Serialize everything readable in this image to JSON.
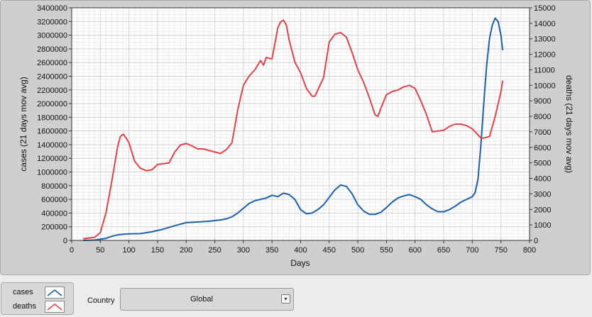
{
  "chart_data": {
    "type": "line",
    "xlabel": "Days",
    "ylabel_left": "cases  (21 days mov avg)",
    "ylabel_right": "deaths  (21 days mov avg)",
    "xlim": [
      0,
      800
    ],
    "ylim_left": [
      0,
      3400000
    ],
    "ylim_right": [
      0,
      15000
    ],
    "x_ticks": [
      "0",
      "50",
      "100",
      "150",
      "200",
      "250",
      "300",
      "350",
      "400",
      "450",
      "500",
      "550",
      "600",
      "650",
      "700",
      "750",
      "800"
    ],
    "y_ticks_left": [
      "0",
      "200000",
      "400000",
      "600000",
      "800000",
      "1000000",
      "1200000",
      "1400000",
      "1600000",
      "1800000",
      "2000000",
      "2200000",
      "2400000",
      "2600000",
      "2800000",
      "3000000",
      "3200000",
      "3400000"
    ],
    "y_ticks_right": [
      "0",
      "1000",
      "2000",
      "3000",
      "4000",
      "5000",
      "6000",
      "7000",
      "8000",
      "9000",
      "10000",
      "11000",
      "12000",
      "13000",
      "14000",
      "15000"
    ],
    "grid": true,
    "series": [
      {
        "name": "cases",
        "axis": "left",
        "color": "#1f5fa6",
        "x": [
          20,
          40,
          60,
          70,
          80,
          90,
          100,
          120,
          140,
          160,
          180,
          200,
          220,
          240,
          260,
          270,
          280,
          290,
          300,
          310,
          320,
          330,
          340,
          350,
          360,
          370,
          380,
          390,
          400,
          410,
          420,
          430,
          440,
          450,
          460,
          470,
          480,
          490,
          500,
          510,
          520,
          530,
          540,
          550,
          560,
          570,
          580,
          590,
          600,
          610,
          620,
          630,
          640,
          650,
          660,
          670,
          680,
          690,
          700,
          705,
          710,
          715,
          720,
          725,
          730,
          735,
          740,
          745,
          750,
          753
        ],
        "y": [
          0,
          5000,
          30000,
          60000,
          80000,
          90000,
          95000,
          100000,
          125000,
          165000,
          215000,
          260000,
          270000,
          280000,
          300000,
          315000,
          345000,
          400000,
          470000,
          540000,
          580000,
          600000,
          620000,
          660000,
          640000,
          690000,
          670000,
          600000,
          450000,
          390000,
          400000,
          450000,
          520000,
          630000,
          740000,
          810000,
          790000,
          680000,
          520000,
          430000,
          380000,
          380000,
          410000,
          480000,
          560000,
          620000,
          650000,
          670000,
          640000,
          600000,
          520000,
          460000,
          420000,
          420000,
          450000,
          500000,
          560000,
          600000,
          640000,
          700000,
          900000,
          1400000,
          2000000,
          2550000,
          2950000,
          3150000,
          3250000,
          3200000,
          3000000,
          2780000
        ]
      },
      {
        "name": "deaths",
        "axis": "right",
        "color": "#e0434a",
        "x": [
          20,
          40,
          50,
          60,
          70,
          80,
          85,
          90,
          95,
          100,
          110,
          120,
          130,
          140,
          150,
          170,
          180,
          190,
          200,
          210,
          220,
          230,
          240,
          250,
          260,
          270,
          280,
          290,
          300,
          310,
          320,
          330,
          335,
          340,
          350,
          360,
          365,
          370,
          375,
          380,
          390,
          400,
          410,
          420,
          425,
          430,
          440,
          450,
          460,
          470,
          480,
          490,
          500,
          510,
          520,
          530,
          535,
          540,
          550,
          560,
          570,
          580,
          590,
          600,
          610,
          620,
          630,
          640,
          650,
          660,
          670,
          680,
          690,
          700,
          710,
          715,
          720,
          730,
          740,
          750,
          753
        ],
        "y": [
          100,
          200,
          500,
          1800,
          3800,
          6000,
          6700,
          6850,
          6600,
          6300,
          5100,
          4650,
          4500,
          4550,
          4900,
          5000,
          5700,
          6150,
          6250,
          6100,
          5900,
          5900,
          5800,
          5700,
          5600,
          5850,
          6300,
          8400,
          10000,
          10600,
          11000,
          11600,
          11300,
          11800,
          11700,
          13700,
          14100,
          14200,
          13900,
          12900,
          11500,
          10800,
          9800,
          9300,
          9300,
          9700,
          10500,
          12800,
          13300,
          13400,
          13100,
          12100,
          11000,
          10200,
          9200,
          8100,
          8000,
          8500,
          9400,
          9600,
          9700,
          9900,
          10000,
          9800,
          9000,
          8100,
          7000,
          7050,
          7100,
          7350,
          7500,
          7500,
          7400,
          7200,
          6800,
          6600,
          6600,
          6700,
          8000,
          9600,
          10300
        ]
      }
    ]
  },
  "legend": {
    "items": [
      {
        "label": "cases",
        "color": "#1f5fa6"
      },
      {
        "label": "deaths",
        "color": "#e0434a"
      }
    ]
  },
  "country": {
    "label": "Country",
    "value": "Global"
  }
}
